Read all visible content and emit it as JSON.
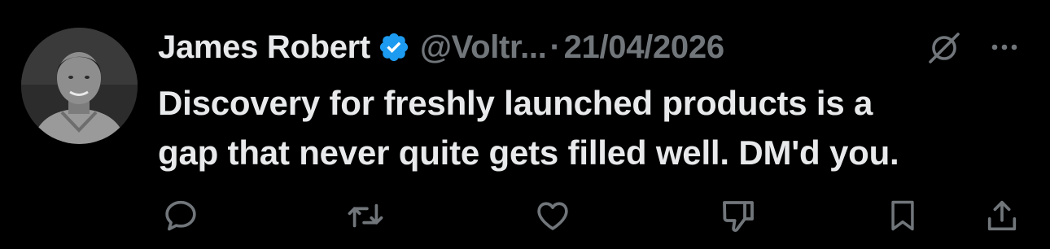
{
  "tweet": {
    "display_name": "James Robert",
    "handle": "@Voltr...",
    "separator": "·",
    "date": "21/04/2026",
    "text_line1": "Discovery for freshly launched products is a",
    "text_line2": "gap that never quite gets filled well. DM'd you."
  },
  "icons": {
    "verified": "verified-badge-icon",
    "grok": "grok-icon",
    "more": "more-icon",
    "reply": "reply-icon",
    "repost": "repost-icon",
    "like": "like-icon",
    "dislike": "dislike-icon",
    "bookmark": "bookmark-icon",
    "share": "share-icon"
  },
  "colors": {
    "background": "#000000",
    "text": "#e7e9ea",
    "secondary": "#71767b",
    "verified": "#1d9bf0"
  }
}
